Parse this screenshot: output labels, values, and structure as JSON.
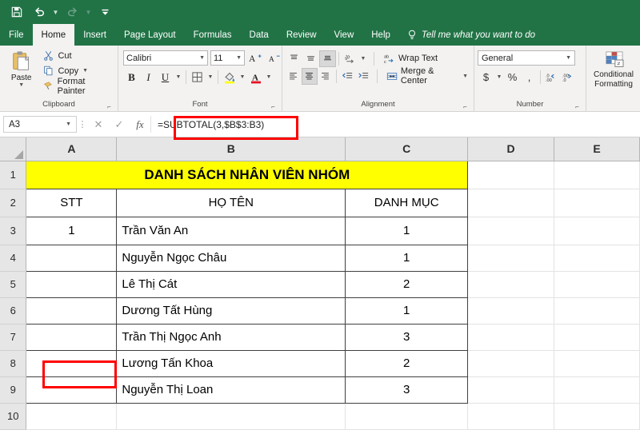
{
  "quick_access": {
    "items": [
      {
        "name": "save-icon",
        "glyph": "💾",
        "label": "Save",
        "enabled": true,
        "caret": false
      },
      {
        "name": "undo-icon",
        "glyph": "↶",
        "label": "Undo",
        "enabled": true,
        "caret": true
      },
      {
        "name": "redo-icon",
        "glyph": "↷",
        "label": "Redo",
        "enabled": false,
        "caret": true
      },
      {
        "name": "customize-quick-access-icon",
        "glyph": "▾",
        "label": "Customize Quick Access Toolbar",
        "enabled": true,
        "caret": false
      }
    ]
  },
  "ribbon": {
    "tabs": [
      {
        "label": "File",
        "active": false
      },
      {
        "label": "Home",
        "active": true
      },
      {
        "label": "Insert",
        "active": false
      },
      {
        "label": "Page Layout",
        "active": false
      },
      {
        "label": "Formulas",
        "active": false
      },
      {
        "label": "Data",
        "active": false
      },
      {
        "label": "Review",
        "active": false
      },
      {
        "label": "View",
        "active": false
      },
      {
        "label": "Help",
        "active": false
      }
    ],
    "tell_me": "Tell me what you want to do",
    "groups": {
      "clipboard": {
        "label": "Clipboard",
        "paste_label": "Paste",
        "items": [
          {
            "label": "Cut",
            "icon": "scissors-icon"
          },
          {
            "label": "Copy",
            "icon": "copy-icon"
          },
          {
            "label": "Format Painter",
            "icon": "format-painter-icon"
          }
        ]
      },
      "font": {
        "label": "Font",
        "font_name": "Calibri",
        "font_size": "11",
        "buttons": [
          "bold",
          "italic",
          "underline",
          "borders",
          "fill-color",
          "font-color"
        ]
      },
      "alignment": {
        "label": "Alignment",
        "wrap_text": "Wrap Text",
        "merge_center": "Merge & Center"
      },
      "number": {
        "label": "Number",
        "format": "General"
      },
      "styles": {
        "conditional_formatting_line1": "Conditional",
        "conditional_formatting_line2": "Formatting"
      }
    }
  },
  "formula_bar": {
    "name_box": "A3",
    "cancel_label": "Cancel",
    "enter_label": "Enter",
    "insert_function_label": "fx",
    "formula": "=SUBTOTAL(3,$B$3:B3)",
    "highlight_color": "#ff0000"
  },
  "sheet": {
    "column_headers": [
      "A",
      "B",
      "C",
      "D",
      "E"
    ],
    "row_headers": [
      "1",
      "2",
      "3",
      "4",
      "5",
      "6",
      "7",
      "8",
      "9",
      "10"
    ],
    "title_cell": "DANH SÁCH NHÂN VIÊN NHÓM",
    "title_fill": "#ffff00",
    "headers": {
      "a": "STT",
      "b": "HỌ TÊN",
      "c": "DANH MỤC"
    },
    "rows": [
      {
        "row": "3",
        "stt": "1",
        "name": "Trần Văn An",
        "category": "1"
      },
      {
        "row": "4",
        "stt": "",
        "name": "Nguyễn Ngọc Châu",
        "category": "1"
      },
      {
        "row": "5",
        "stt": "",
        "name": "Lê Thị Cát",
        "category": "2"
      },
      {
        "row": "6",
        "stt": "",
        "name": "Dương Tất Hùng",
        "category": "1"
      },
      {
        "row": "7",
        "stt": "",
        "name": "Trần Thị Ngọc Anh",
        "category": "3"
      },
      {
        "row": "8",
        "stt": "",
        "name": "Lương Tấn Khoa",
        "category": "2"
      },
      {
        "row": "9",
        "stt": "",
        "name": "Nguyễn Thị Loan",
        "category": "3"
      }
    ],
    "selected_cell": "A3",
    "selection_highlight_color": "#ff0000"
  }
}
